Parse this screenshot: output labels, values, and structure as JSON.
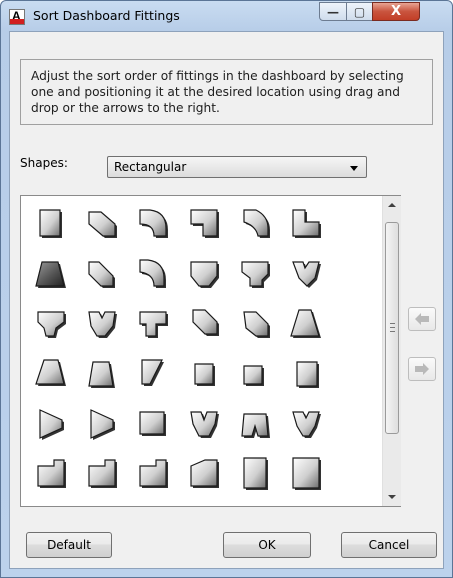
{
  "window": {
    "title": "Sort Dashboard Fittings",
    "app_icon_letter": "A",
    "minimize_glyph": "—",
    "maximize_glyph": "▢",
    "close_glyph": "X"
  },
  "description": "Adjust the sort order of fittings in the dashboard by selecting one and positioning it at the desired location using drag and drop or the arrows to the right.",
  "shapes": {
    "label": "Shapes:",
    "selected": "Rectangular"
  },
  "fittings": [
    "rect-straight",
    "rect-elbow-mitered",
    "rect-elbow-radius",
    "rect-elbow-square",
    "rect-elbow-radius-throat",
    "rect-elbow-square-throat",
    "rect-transition-dark",
    "rect-elbow-mitered-2",
    "rect-elbow-radius-2",
    "rect-tee",
    "rect-tee-radius",
    "rect-wye",
    "rect-tee-2",
    "rect-wye-2",
    "rect-tee-3",
    "rect-offset",
    "rect-offset-2",
    "rect-transition",
    "rect-transition-2",
    "rect-transition-3",
    "rect-takeoff",
    "rect-cap",
    "rect-cap-2",
    "rect-damper",
    "rect-transition-4",
    "rect-transition-5",
    "rect-end-cap",
    "rect-wye-3",
    "rect-pants",
    "rect-wye-4",
    "rect-elbow-end",
    "rect-elbow-end-2",
    "rect-elbow-end-3",
    "rect-elbow-end-4",
    "rect-grille",
    "rect-grille-2"
  ],
  "buttons": {
    "default": "Default",
    "ok": "OK",
    "cancel": "Cancel"
  },
  "side_buttons": {
    "move_up_icon": "arrow-left-icon",
    "move_down_icon": "arrow-right-icon"
  }
}
